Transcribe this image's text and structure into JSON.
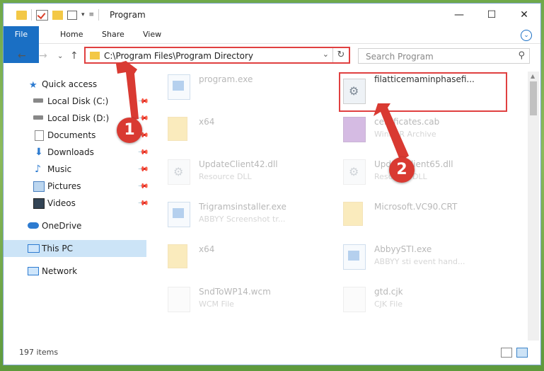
{
  "window": {
    "title": "Program",
    "controls": [
      "minimize-icon",
      "maximize-icon",
      "close-icon"
    ]
  },
  "ribbon": {
    "tabs": [
      "File",
      "Home",
      "Share",
      "View"
    ]
  },
  "nav": {
    "address": "C:\\Program Files\\Program Directory",
    "search_placeholder": "Search Program"
  },
  "sidebar": {
    "items": [
      {
        "label": "Quick access",
        "icon": "star-icon",
        "pinned": false
      },
      {
        "label": "Local Disk (C:)",
        "icon": "drive-icon",
        "pinned": true
      },
      {
        "label": "Local Disk (D:)",
        "icon": "drive-icon",
        "pinned": true
      },
      {
        "label": "Documents",
        "icon": "document-icon",
        "pinned": true
      },
      {
        "label": "Downloads",
        "icon": "download-icon",
        "pinned": true
      },
      {
        "label": "Music",
        "icon": "music-icon",
        "pinned": true
      },
      {
        "label": "Pictures",
        "icon": "pictures-icon",
        "pinned": true
      },
      {
        "label": "Videos",
        "icon": "video-icon",
        "pinned": true
      },
      {
        "label": "OneDrive",
        "icon": "cloud-icon",
        "pinned": false
      },
      {
        "label": "This PC",
        "icon": "computer-icon",
        "pinned": false,
        "selected": true
      },
      {
        "label": "Network",
        "icon": "network-icon",
        "pinned": false
      }
    ]
  },
  "files": [
    {
      "name": "program.exe",
      "desc": "",
      "icon": "app"
    },
    {
      "name": "filatticemaminphasefi...",
      "desc": "",
      "icon": "gear",
      "highlighted": true
    },
    {
      "name": "x64",
      "desc": "",
      "icon": "folder"
    },
    {
      "name": "certificates.cab",
      "desc": "WinRAR Archive",
      "icon": "archive"
    },
    {
      "name": "UpdateClient42.dll",
      "desc": "Resource DLL",
      "icon": "gear"
    },
    {
      "name": "UpdateClient65.dll",
      "desc": "Resource DLL",
      "icon": "gear"
    },
    {
      "name": "Trigramsinstaller.exe",
      "desc": "ABBYY Screenshot tr...",
      "icon": "app"
    },
    {
      "name": "Microsoft.VC90.CRT",
      "desc": "",
      "icon": "folder"
    },
    {
      "name": "x64",
      "desc": "",
      "icon": "folder"
    },
    {
      "name": "AbbyySTI.exe",
      "desc": "ABBYY sti event hand...",
      "icon": "app"
    },
    {
      "name": "SndToWP14.wcm",
      "desc": "WCM File",
      "icon": "blank"
    },
    {
      "name": "gtd.cjk",
      "desc": "CJK File",
      "icon": "blank"
    }
  ],
  "status": {
    "count": "197 items"
  },
  "callouts": [
    "1",
    "2"
  ],
  "colors": {
    "accent": "#1a6fc4",
    "highlight": "#e04040",
    "callout": "#d93a32"
  }
}
